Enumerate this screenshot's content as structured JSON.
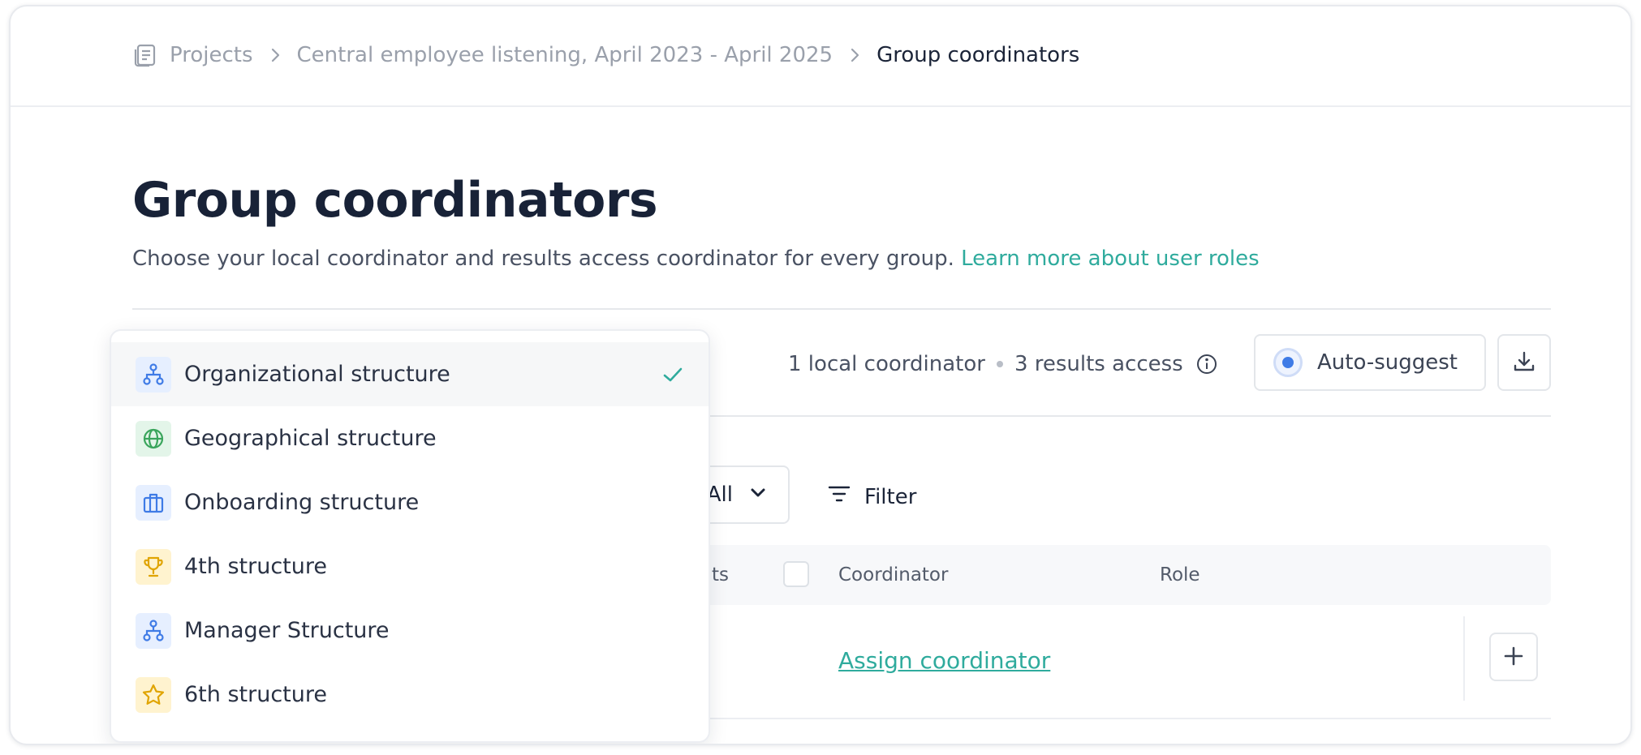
{
  "breadcrumb": {
    "items": [
      "Projects",
      "Central employee listening, April 2023 - April 2025"
    ],
    "current": "Group coordinators"
  },
  "page": {
    "title": "Group coordinators",
    "subtitle": "Choose your local coordinator and results access coordinator for every group.",
    "learn_more": "Learn more about user roles"
  },
  "toolbar": {
    "local_count": "1 local coordinator",
    "results_count": "3 results access",
    "auto_suggest": "Auto-suggest"
  },
  "filters": {
    "select_value": "All",
    "filter_label": "Filter"
  },
  "table": {
    "headers": {
      "col_partial": "ts",
      "coordinator": "Coordinator",
      "role": "Role"
    },
    "row": {
      "assign": "Assign coordinator"
    }
  },
  "dropdown": {
    "options": [
      {
        "label": "Organizational structure",
        "icon": "org-chart-icon",
        "selected": true
      },
      {
        "label": "Geographical structure",
        "icon": "globe-icon"
      },
      {
        "label": "Onboarding structure",
        "icon": "briefcase-icon"
      },
      {
        "label": "4th structure",
        "icon": "trophy-icon"
      },
      {
        "label": "Manager Structure",
        "icon": "org-chart-icon"
      },
      {
        "label": "6th structure",
        "icon": "star-icon"
      }
    ]
  },
  "colors": {
    "accent": "#2fab9d",
    "primary_text": "#182237",
    "blue": "#3f7be6"
  }
}
